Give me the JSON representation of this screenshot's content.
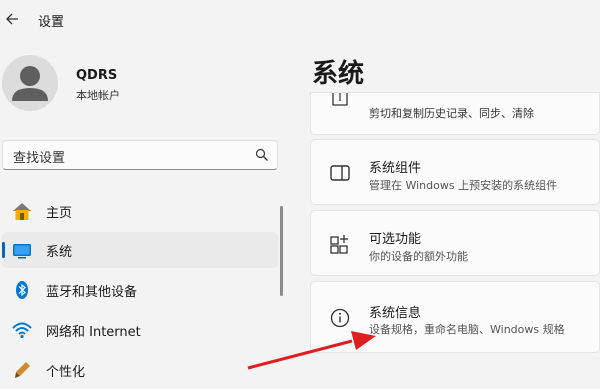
{
  "window": {
    "title": "设置"
  },
  "user": {
    "name": "QDRS",
    "account_type": "本地帐户"
  },
  "search": {
    "placeholder": "查找设置"
  },
  "nav": {
    "items": [
      {
        "label": "主页",
        "icon": "home-icon"
      },
      {
        "label": "系统",
        "icon": "system-icon",
        "selected": true
      },
      {
        "label": "蓝牙和其他设备",
        "icon": "bluetooth-icon"
      },
      {
        "label": "网络和 Internet",
        "icon": "wifi-icon"
      },
      {
        "label": "个性化",
        "icon": "personalization-icon"
      }
    ]
  },
  "main": {
    "title": "系统",
    "cards": [
      {
        "title": "",
        "subtitle": "剪切和复制历史记录、同步、清除",
        "icon": "clipboard-icon"
      },
      {
        "title": "系统组件",
        "subtitle": "管理在 Windows 上预安装的系统组件",
        "icon": "components-icon"
      },
      {
        "title": "可选功能",
        "subtitle": "你的设备的额外功能",
        "icon": "optional-features-icon"
      },
      {
        "title": "系统信息",
        "subtitle": "设备规格，重命名电脑、Windows 规格",
        "icon": "info-icon"
      }
    ]
  },
  "colors": {
    "accent": "#0067c0",
    "annotation_arrow": "#e02020"
  }
}
